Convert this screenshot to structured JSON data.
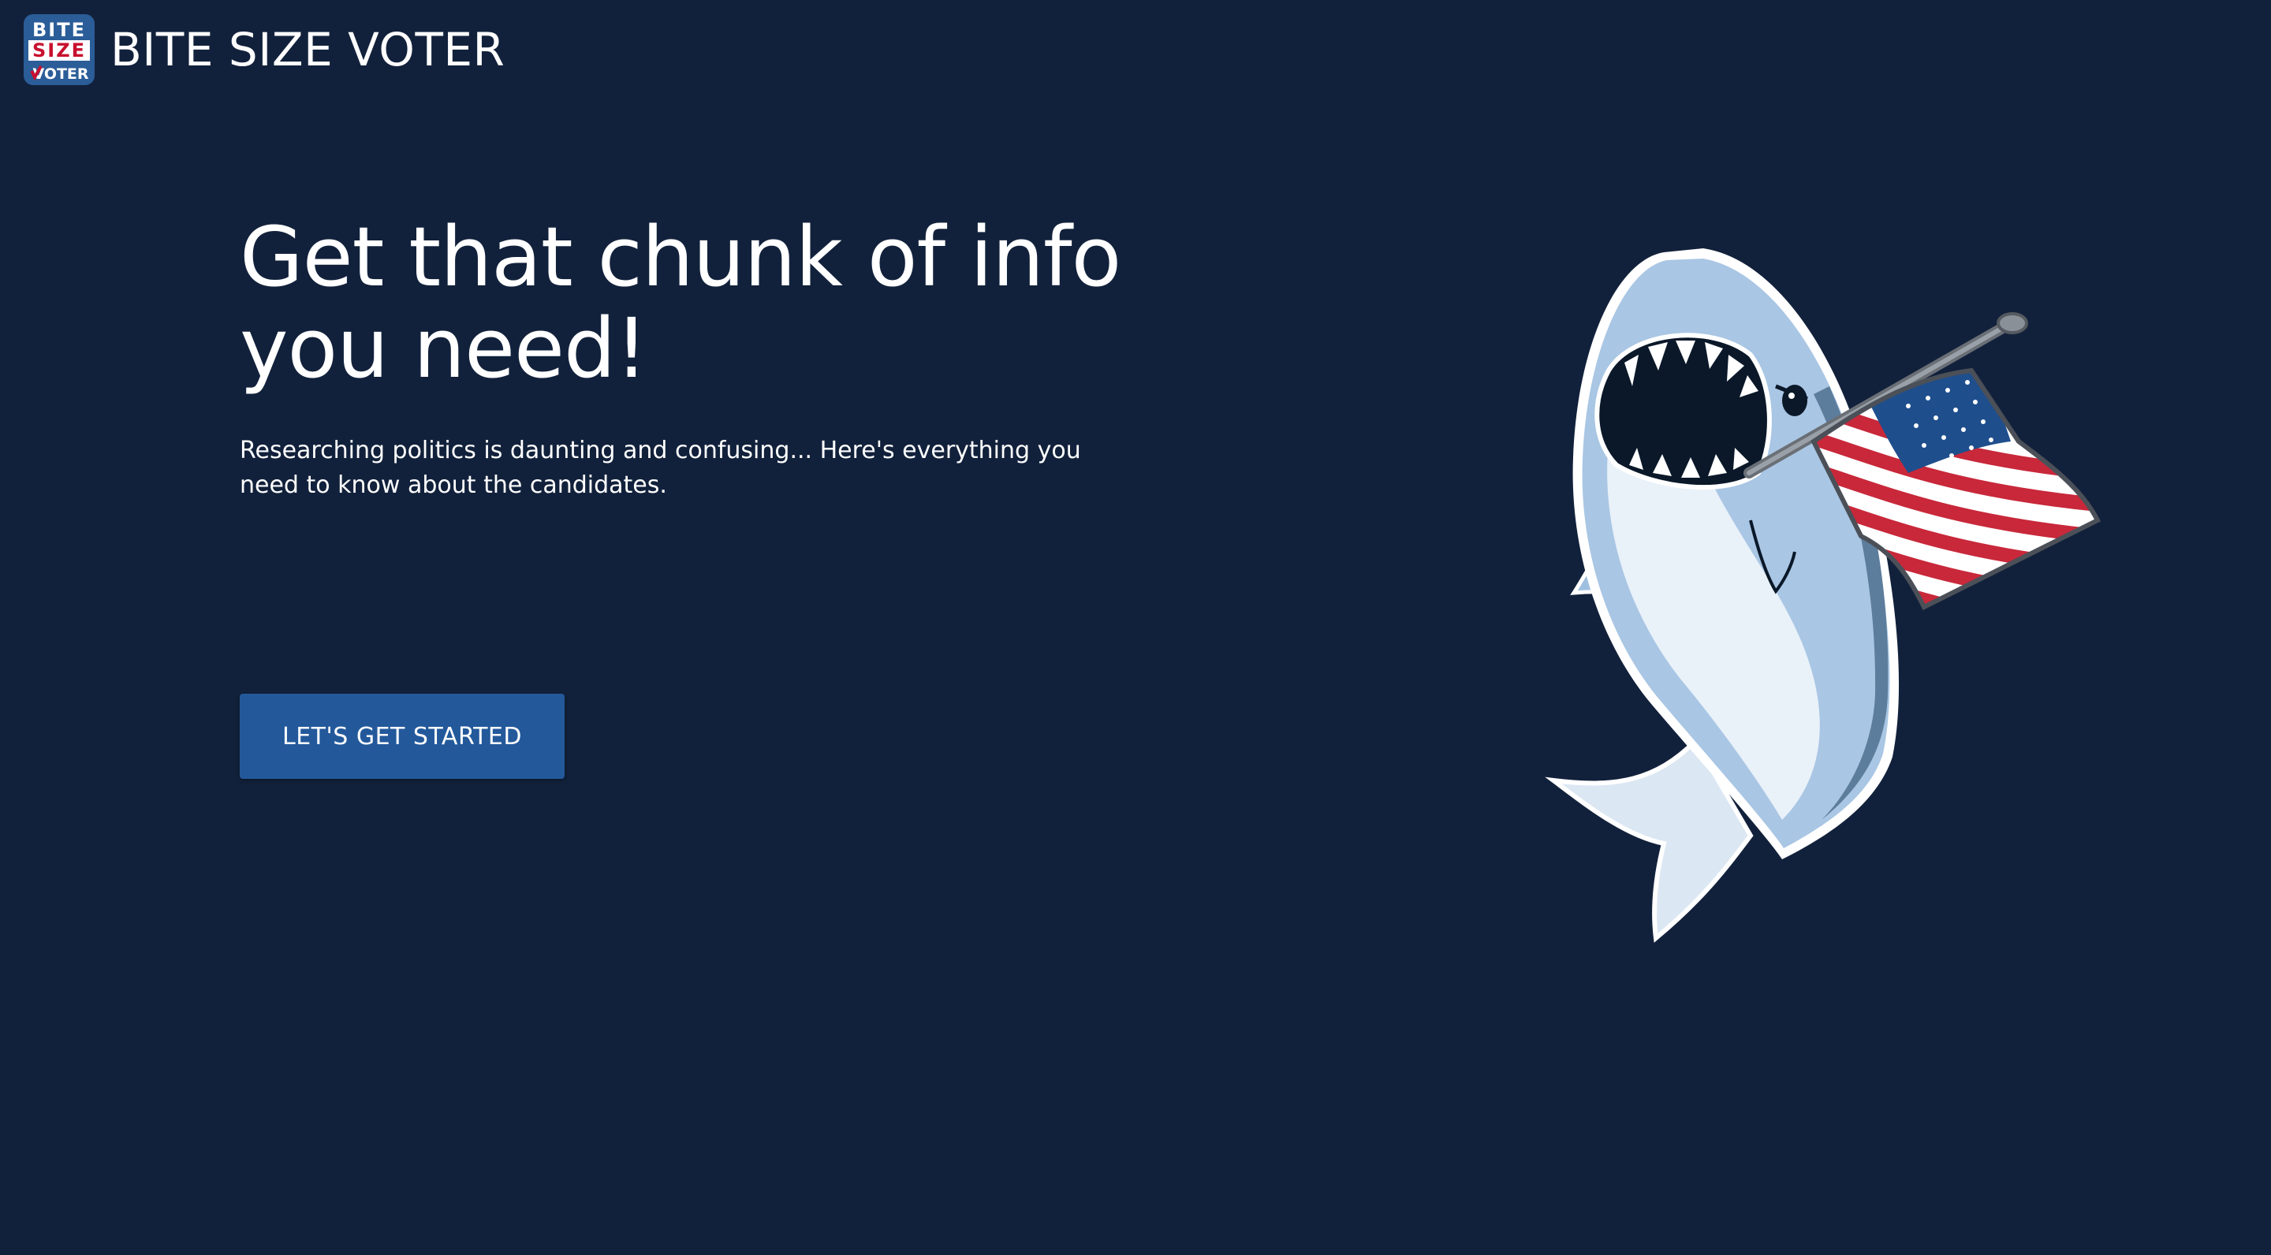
{
  "header": {
    "logo": {
      "line1": "BITE",
      "line2": "SIZE",
      "line3": "VOTER"
    },
    "brand_name": "BITE SIZE VOTER"
  },
  "hero": {
    "title_line1": "Get that chunk of info",
    "title_line2": "you need!",
    "subtitle": "Researching politics is daunting and confusing... Here's everything you need to know about the candidates.",
    "cta_label": "LET'S GET STARTED"
  },
  "illustration": {
    "icon": "shark-with-flag-illustration"
  },
  "colors": {
    "background": "#12213b",
    "button": "#23599b",
    "text": "#ffffff",
    "logo_red": "#c8102e",
    "logo_blue": "#1f4e8c"
  }
}
